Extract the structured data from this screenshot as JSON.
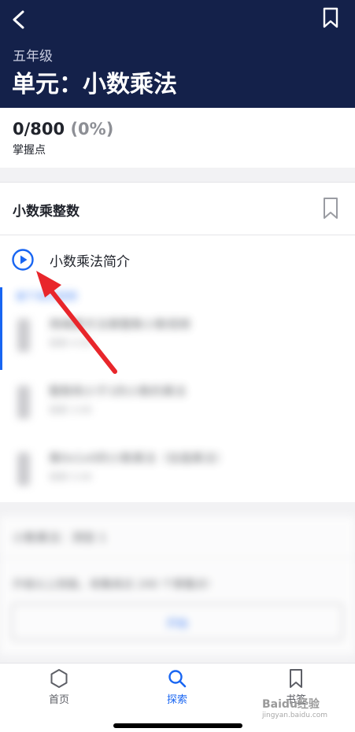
{
  "header": {
    "grade": "五年级",
    "title": "单元：小数乘法"
  },
  "progress": {
    "count": "0/800",
    "percent": "(0%)",
    "label": "掌握点"
  },
  "lesson": {
    "title": "小数乘整数",
    "video_label": "小数乘法简介",
    "next_link": "接下来的视频",
    "items": [
      {
        "title": "用绳索方法乘整数小数视频",
        "sub": "视频 4:00"
      },
      {
        "title": "整数和小于1的小数的乘法",
        "sub": "视频 3:00"
      },
      {
        "title": "像0x1x0的小数乘法（估值乘法）",
        "sub": "视频 5:00"
      }
    ]
  },
  "quiz": {
    "title": "小数乘法：测验 1",
    "description": "升级以上技能，收集高达 240 个掌握点!",
    "button_label": "开始"
  },
  "tabbar": {
    "home": "首页",
    "explore": "探索",
    "bookmarks": "书签"
  },
  "watermark": {
    "text": "Baidu经验",
    "url": "jingyan.baidu.com"
  },
  "colors": {
    "header_bg": "#14214a",
    "accent": "#1865f2",
    "annotation_arrow": "#e8262b"
  }
}
